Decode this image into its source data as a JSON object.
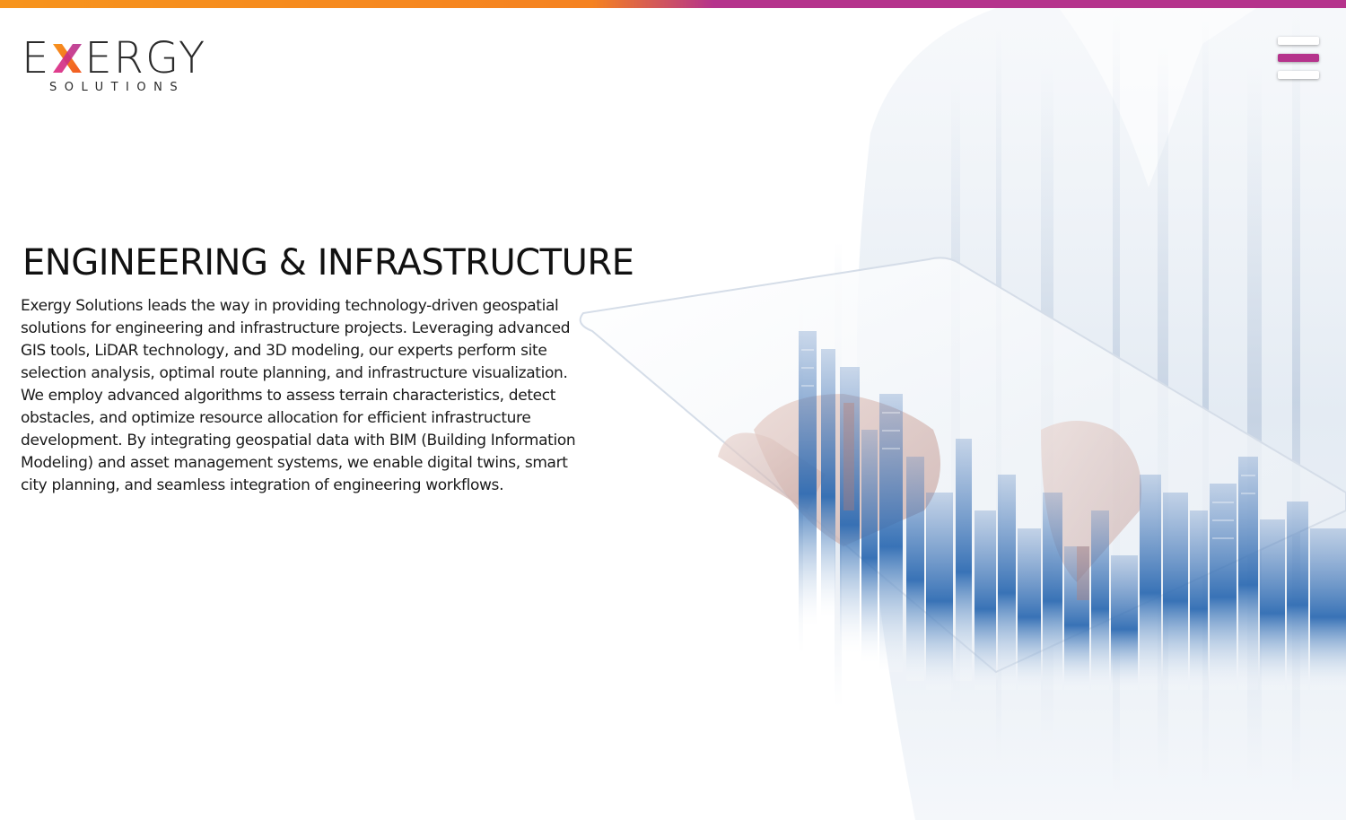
{
  "brand": {
    "name": "EXERGY",
    "tagline": "SOLUTIONS",
    "accent_orange": "#f7941d",
    "accent_magenta": "#b5338c"
  },
  "nav": {
    "menu_icon": "hamburger-menu-icon"
  },
  "hero": {
    "image": "hand-holding-tablet-with-city-skyline-illustration"
  },
  "content": {
    "heading": "ENGINEERING & INFRASTRUCTURE",
    "paragraph": "Exergy Solutions leads the way in providing technology-driven geospatial solutions for engineering and infrastructure projects. Leveraging advanced GIS tools, LiDAR technology, and 3D modeling, our experts perform site selection analysis, optimal route planning, and infrastructure visualization. We employ advanced algorithms to assess terrain characteristics, detect obstacles, and optimize resource allocation for efficient infrastructure development. By integrating geospatial data with BIM (Building Information Modeling) and asset management systems, we enable digital twins, smart city planning, and seamless integration of engineering workflows."
  }
}
